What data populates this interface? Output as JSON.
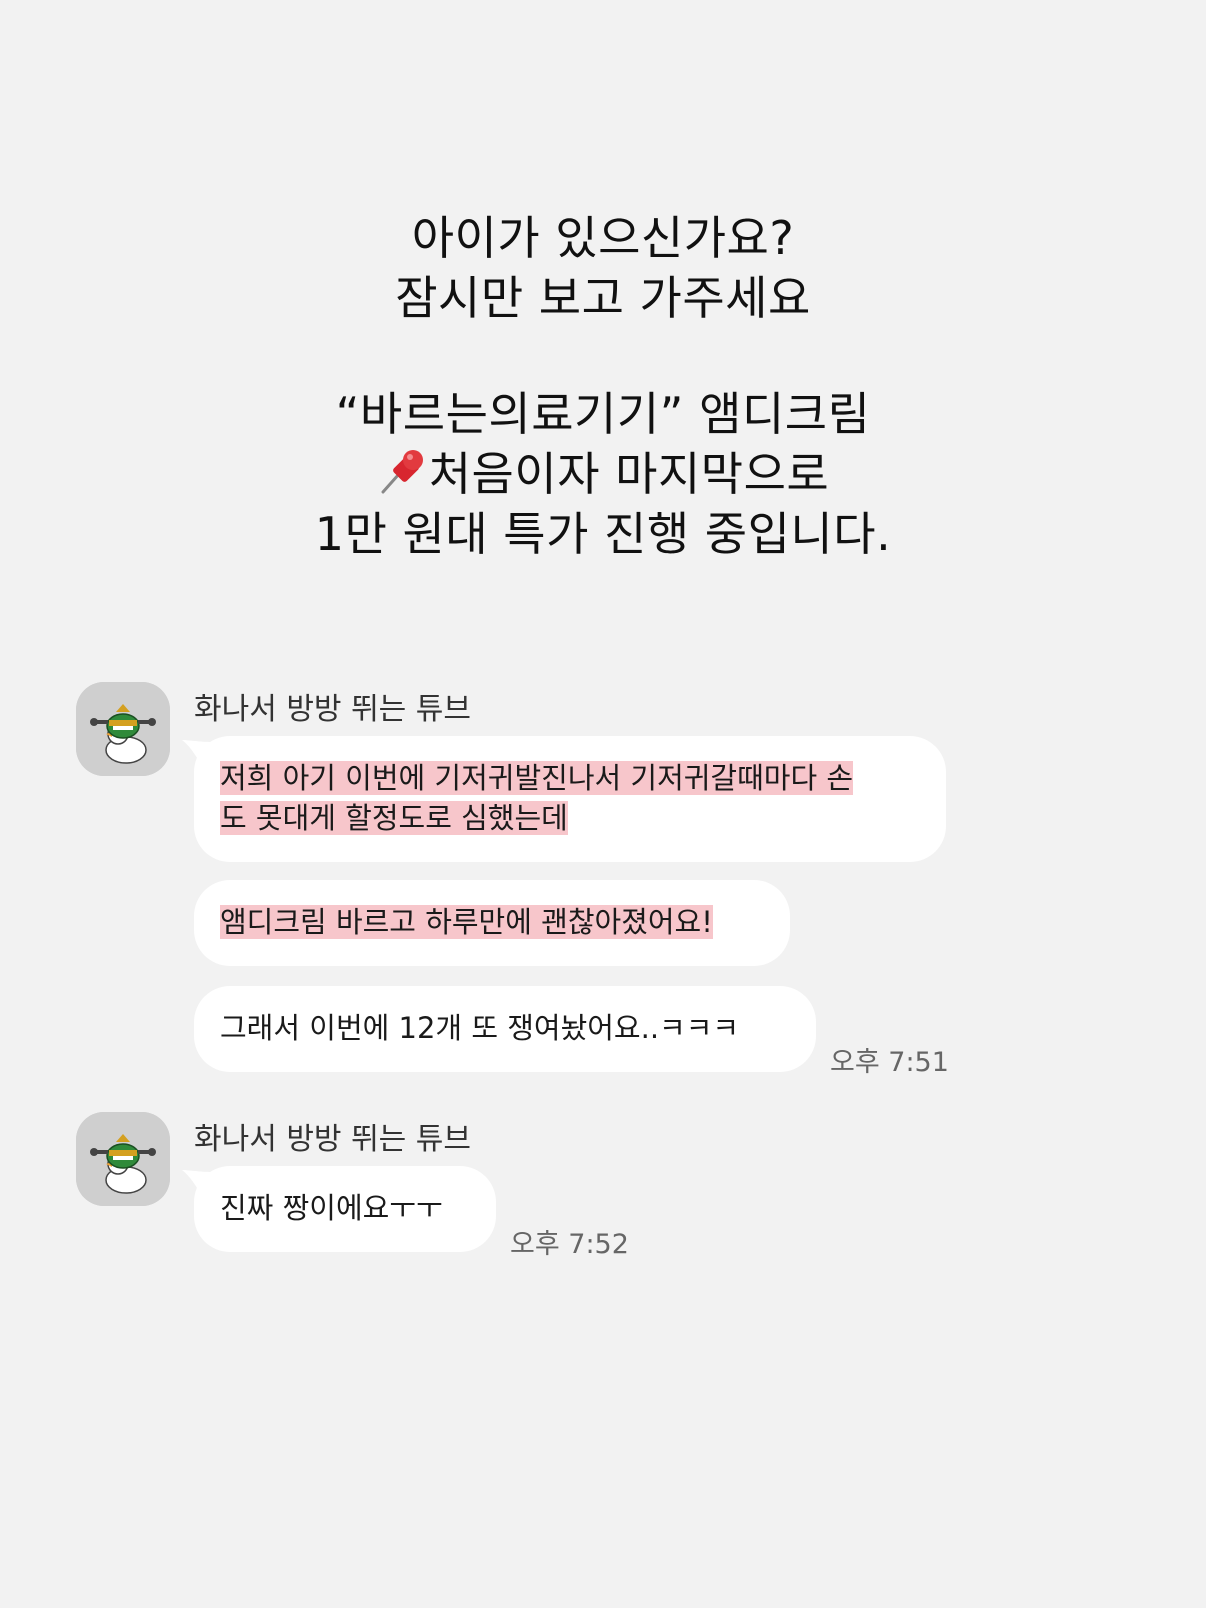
{
  "headline": {
    "line1": "아이가 있으신가요?",
    "line2": "잠시만 보고 가주세요",
    "line3": "“바르는의료기기” 앰디크림",
    "line4": "처음이자 마지막으로",
    "line5": "1만 원대 특가 진행 중입니다.",
    "pin_icon": "pushpin-icon"
  },
  "chat": {
    "groups": [
      {
        "sender": "화나서 방방 뛰는 튜브",
        "avatar_icon": "duck-character-avatar",
        "messages": [
          {
            "line1": "저희 아기 이번에 기저귀발진나서 기저귀갈때마다 손",
            "line2": "도 못대게 할정도로 심했는데",
            "highlighted": true
          },
          {
            "text": "앰디크림 바르고 하루만에 괜찮아졌어요!",
            "highlighted": true
          },
          {
            "text": "그래서 이번에 12개 또 쟁여놨어요..ㅋㅋㅋ",
            "highlighted": false
          }
        ],
        "time": "오후 7:51"
      },
      {
        "sender": "화나서 방방 뛰는 튜브",
        "avatar_icon": "duck-character-avatar",
        "messages": [
          {
            "text": "진짜 짱이에요ㅜㅜ",
            "highlighted": false
          }
        ],
        "time": "오후 7:52"
      }
    ]
  },
  "colors": {
    "background": "#f2f2f2",
    "bubble": "#ffffff",
    "highlight": "#f7c6cb",
    "avatar_bg": "#cfcfcf"
  }
}
